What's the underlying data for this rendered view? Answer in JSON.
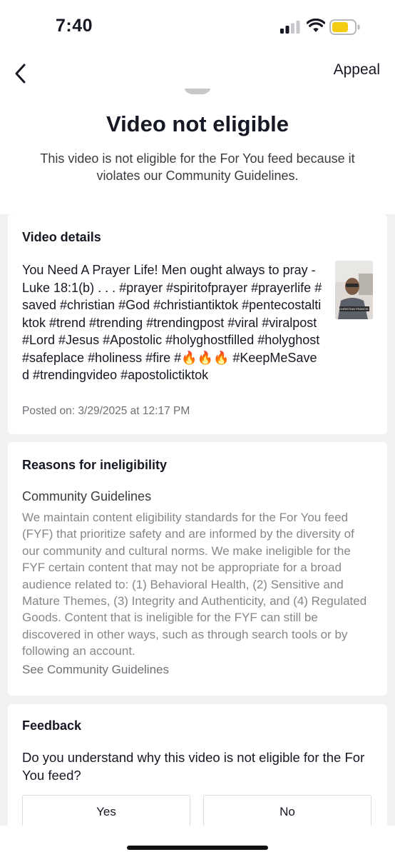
{
  "status_bar": {
    "time": "7:40",
    "icons": [
      "cellular-signal-icon",
      "wifi-icon",
      "battery-icon"
    ],
    "battery_color": "#f5cc14"
  },
  "header": {
    "back_icon": "chevron-left-icon",
    "appeal_label": "Appeal"
  },
  "hero": {
    "title": "Video not eligible",
    "description": "This video is not eligible for the For You feed because it violates our Community Guidelines."
  },
  "video_details": {
    "heading": "Video details",
    "caption": "You Need A Prayer Life!   Men ought always to pray - Luke 18:1(b) . . . #prayer #spiritofprayer #prayerlife #saved #christian #God #christiantiktok #pentecostaltiktok #trend #trending #trendingpost #viral #viralpost #Lord #Jesus #Apostolic #holyghostfilled #holyghost #safeplace #holiness #fire #🔥🔥🔥 #KeepMeSaved #trendingvideo #apostolictiktok",
    "posted": "Posted on: 3/29/2025 at 12:17 PM",
    "thumbnail_label": "CHRISTIAN FRANCIS"
  },
  "reasons": {
    "heading": "Reasons for ineligibility",
    "subheading": "Community Guidelines",
    "body": "We maintain content eligibility standards for the For You feed (FYF) that prioritize safety and are informed by the diversity of our community and cultural norms. We make ineligible for the FYF certain content that may not be appropriate for a broad audience related to: (1) Behavioral Health, (2) Sensitive and Mature Themes, (3) Integrity and Authenticity, and (4) Regulated Goods. Content that is ineligible for the FYF can still be discovered in other ways, such as through search tools or by following an account.",
    "link": "See Community Guidelines"
  },
  "feedback": {
    "heading": "Feedback",
    "question": "Do you understand why this video is not eligible for the For You feed?",
    "yes_label": "Yes",
    "no_label": "No"
  }
}
